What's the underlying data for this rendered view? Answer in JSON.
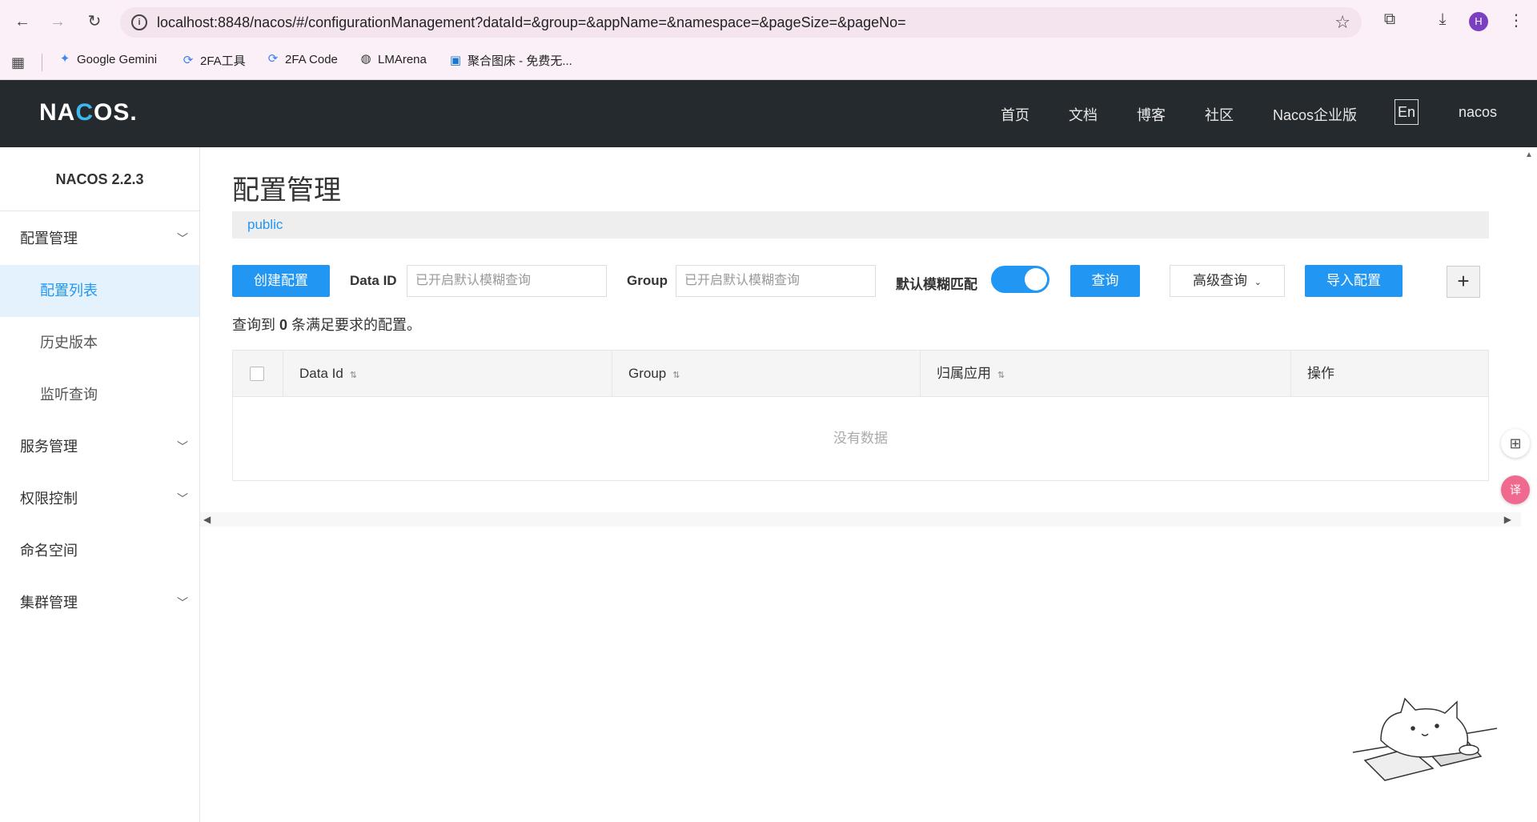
{
  "browser": {
    "url": "localhost:8848/nacos/#/configurationManagement?dataId=&group=&appName=&namespace=&pageSize=&pageNo=",
    "avatar_letter": "H",
    "bookmarks": [
      {
        "label": "Google Gemini",
        "icon": "gemini-icon"
      },
      {
        "label": "2FA工具",
        "icon": "2fa-icon"
      },
      {
        "label": "2FA Code",
        "icon": "2fa-icon"
      },
      {
        "label": "LMArena",
        "icon": "globe-icon"
      },
      {
        "label": "聚合图床 - 免费无...",
        "icon": "image-icon"
      }
    ]
  },
  "topbar": {
    "logo": "NACOS.",
    "nav": [
      "首页",
      "文档",
      "博客",
      "社区",
      "Nacos企业版"
    ],
    "lang": "En",
    "user": "nacos"
  },
  "sidebar": {
    "version": "NACOS 2.2.3",
    "items": [
      {
        "label": "配置管理",
        "expandable": true
      },
      {
        "label": "配置列表",
        "active": true
      },
      {
        "label": "历史版本"
      },
      {
        "label": "监听查询"
      },
      {
        "label": "服务管理",
        "expandable": true
      },
      {
        "label": "权限控制",
        "expandable": true
      },
      {
        "label": "命名空间"
      },
      {
        "label": "集群管理",
        "expandable": true
      }
    ]
  },
  "main": {
    "title": "配置管理",
    "namespace": "public",
    "toolbar": {
      "create_label": "创建配置",
      "dataid_label": "Data ID",
      "dataid_placeholder": "已开启默认模糊查询",
      "group_label": "Group",
      "group_placeholder": "已开启默认模糊查询",
      "fuzzy_label": "默认模糊匹配",
      "fuzzy_enabled": true,
      "query_label": "查询",
      "advanced_label": "高级查询",
      "import_label": "导入配置",
      "plus_label": "+"
    },
    "result": {
      "prefix": "查询到",
      "count": "0",
      "suffix": "条满足要求的配置。"
    },
    "table": {
      "columns": [
        "Data Id",
        "Group",
        "归属应用",
        "操作"
      ],
      "empty_text": "没有数据"
    }
  },
  "colors": {
    "accent": "#2196f3",
    "topbar": "#252a2f",
    "active_bg": "#e4f2fd"
  }
}
